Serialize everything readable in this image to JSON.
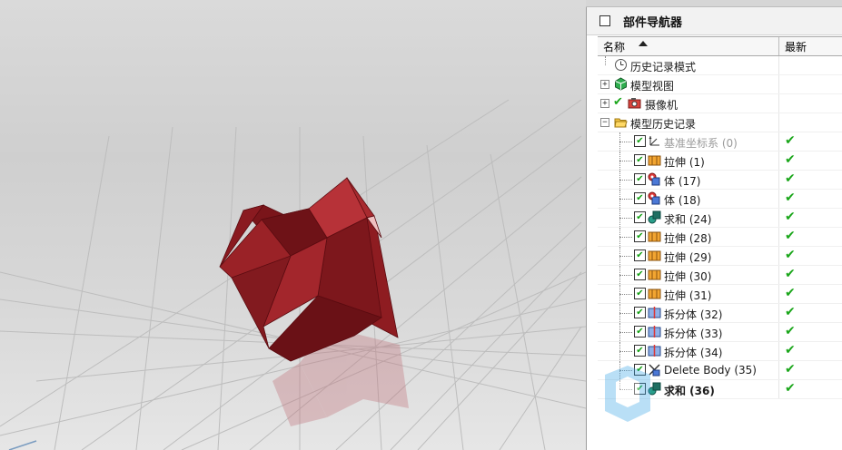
{
  "navigator": {
    "title": "部件导航器",
    "columns": {
      "name": "名称",
      "latest": "最新"
    },
    "top_items": [
      {
        "label": "历史记录模式",
        "icon": "clock-icon"
      },
      {
        "label": "模型视图",
        "icon": "model-views-icon"
      },
      {
        "label": "摄像机",
        "icon": "camera-icon"
      },
      {
        "label": "模型历史记录",
        "icon": "folder-open-icon"
      }
    ],
    "features": [
      {
        "label": "基准坐标系 (0)",
        "icon": "datum-csys-icon",
        "latest": "✔"
      },
      {
        "label": "拉伸 (1)",
        "icon": "extrude-icon",
        "latest": "✔"
      },
      {
        "label": "体 (17)",
        "icon": "body-icon",
        "latest": "✔"
      },
      {
        "label": "体 (18)",
        "icon": "body-icon",
        "latest": "✔"
      },
      {
        "label": "求和 (24)",
        "icon": "unite-icon",
        "latest": "✔"
      },
      {
        "label": "拉伸 (28)",
        "icon": "extrude-icon",
        "latest": "✔"
      },
      {
        "label": "拉伸 (29)",
        "icon": "extrude-icon",
        "latest": "✔"
      },
      {
        "label": "拉伸 (30)",
        "icon": "extrude-icon",
        "latest": "✔"
      },
      {
        "label": "拉伸 (31)",
        "icon": "extrude-icon",
        "latest": "✔"
      },
      {
        "label": "拆分体 (32)",
        "icon": "split-body-icon",
        "latest": "✔"
      },
      {
        "label": "拆分体 (33)",
        "icon": "split-body-icon",
        "latest": "✔"
      },
      {
        "label": "拆分体 (34)",
        "icon": "split-body-icon",
        "latest": "✔"
      },
      {
        "label": "Delete Body (35)",
        "icon": "delete-body-icon",
        "latest": "✔"
      },
      {
        "label": "求和 (36)",
        "icon": "unite-icon",
        "latest": "✔"
      }
    ]
  },
  "colors": {
    "model": "#8b1a1f",
    "check": "#1aa61a",
    "background": "#d4d4d4"
  }
}
